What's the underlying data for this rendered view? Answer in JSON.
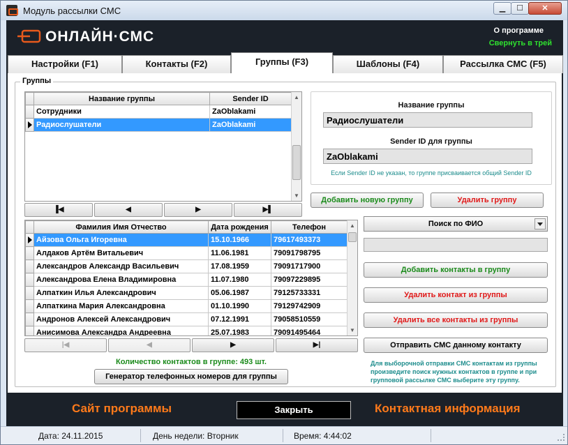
{
  "window": {
    "title": "Модуль рассылки СМС",
    "icon": "sms-app-icon",
    "controls": {
      "minimize": "▁",
      "maximize": "☐",
      "close": "✕"
    }
  },
  "header": {
    "logo_text": "ОНЛАЙН·СМС",
    "about": "О программе",
    "to_tray": "Свернуть в трей"
  },
  "tabs": [
    {
      "label": "Настройки (F1)",
      "active": false
    },
    {
      "label": "Контакты (F2)",
      "active": false
    },
    {
      "label": "Группы (F3)",
      "active": true
    },
    {
      "label": "Шаблоны (F4)",
      "active": false
    },
    {
      "label": "Рассылка СМС (F5)",
      "active": false
    }
  ],
  "groups_panel": {
    "label": "Группы",
    "table": {
      "columns": [
        "Название группы",
        "Sender ID"
      ],
      "rows": [
        {
          "name": "Сотрудники",
          "sender": "ZaOblakami",
          "selected": false
        },
        {
          "name": "Радиослушатели",
          "sender": "ZaOblakami",
          "selected": true
        }
      ]
    },
    "nav": {
      "first": "▐◀",
      "prev": "◀",
      "next": "▶",
      "last": "▶▌"
    }
  },
  "group_form": {
    "name_label": "Название группы",
    "name_value": "Радиослушатели",
    "sender_label": "Sender ID для группы",
    "sender_value": "ZaOblakami",
    "hint": "Если Sender ID не указан, то группе присваивается общий Sender ID",
    "add_button": "Добавить новую группу",
    "delete_button": "Удалить группу"
  },
  "contacts_panel": {
    "columns": [
      "Фамилия Имя Отчество",
      "Дата рождения",
      "Телефон"
    ],
    "rows": [
      {
        "name": "Айзова Ольга Игоревна",
        "birth": "15.10.1966",
        "phone": "79617493373",
        "selected": true
      },
      {
        "name": "Алдаков Артём Витальевич",
        "birth": "11.06.1981",
        "phone": "79091798795",
        "selected": false
      },
      {
        "name": "Александров Александр Васильевич",
        "birth": "17.08.1959",
        "phone": "79091717900",
        "selected": false
      },
      {
        "name": "Александрова Елена Владимировна",
        "birth": "11.07.1980",
        "phone": "79097229895",
        "selected": false
      },
      {
        "name": "Алпаткин Илья Александрович",
        "birth": "05.06.1987",
        "phone": "79125733331",
        "selected": false
      },
      {
        "name": "Алпаткина Мария Александровна",
        "birth": "01.10.1990",
        "phone": "79129742909",
        "selected": false
      },
      {
        "name": "Андронов Алексей Александрович",
        "birth": "07.12.1991",
        "phone": "79058510559",
        "selected": false
      },
      {
        "name": "Анисимова Александра Андреевна",
        "birth": "25.07.1983",
        "phone": "79091495464",
        "selected": false
      }
    ],
    "nav": {
      "first": "|◀",
      "prev": "◀",
      "next": "▶",
      "last": "▶|"
    },
    "count_text": "Количество контактов в группе: 493 шт.",
    "generator_button": "Генератор телефонных номеров для группы"
  },
  "contact_actions": {
    "search_mode": "Поиск по ФИО",
    "search_value": "",
    "add_contacts": "Добавить контакты в группу",
    "remove_contact": "Удалить контакт из группы",
    "remove_all": "Удалить все контакты из группы",
    "send_sms": "Отправить СМС данному контакту",
    "note": "Для выборочной отправки СМС контактам из группы произведите поиск нужных контактов в группе и при групповой рассылке СМС выберите эту группу."
  },
  "footer": {
    "site_link": "Сайт программы",
    "close_button": "Закрыть",
    "contact_link": "Контактная информация"
  },
  "statusbar": {
    "date": "Дата: 24.11.2015",
    "weekday": "День недели: Вторник",
    "time": "Время: 4:44:02"
  },
  "colors": {
    "dark_bg": "#1b2129",
    "accent_orange": "#ff7a1a",
    "accent_green": "#2fe02f",
    "selection": "#3399ff",
    "danger": "#e01818",
    "hint_teal": "#1c8c8c"
  }
}
